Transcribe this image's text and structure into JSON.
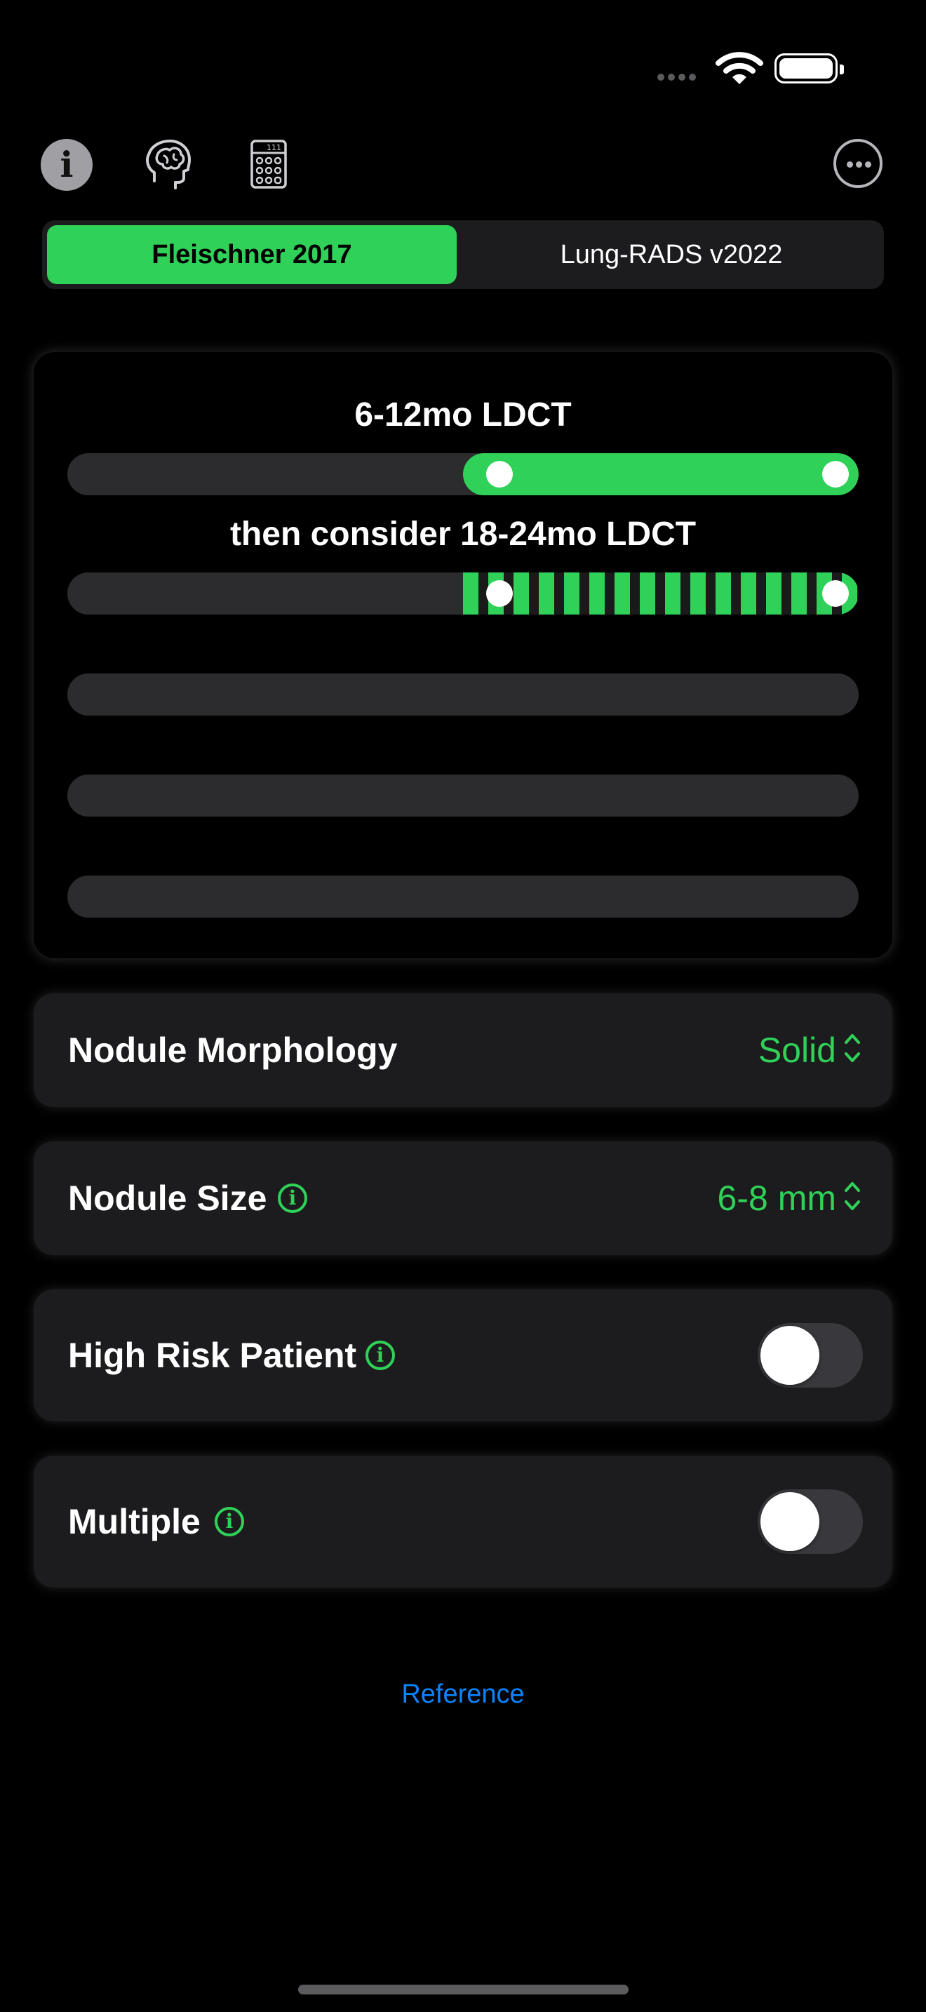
{
  "status_bar": {
    "icons": [
      "signal-dots-icon",
      "wifi-icon",
      "battery-icon"
    ],
    "battery_level": 1.0
  },
  "toolbar": {
    "icons": [
      "info-icon",
      "brain-icon",
      "calculator-icon",
      "more-icon"
    ],
    "calculator_display": "111"
  },
  "segmented": {
    "options": [
      {
        "label": "Fleischner 2017",
        "selected": true
      },
      {
        "label": "Lung-RADS v2022",
        "selected": false
      }
    ]
  },
  "results": {
    "primary_label": "6-12mo LDCT",
    "secondary_label": "then consider 18-24mo LDCT",
    "empty_tracks": 3
  },
  "options": {
    "morphology": {
      "label": "Nodule Morphology",
      "value": "Solid"
    },
    "size": {
      "label": "Nodule Size",
      "value": "6-8 mm"
    },
    "high_risk": {
      "label": "High Risk Patient",
      "on": false
    },
    "multiple": {
      "label": "Multiple",
      "on": false
    }
  },
  "footer": {
    "reference_label": "Reference"
  },
  "colors": {
    "accent": "#30d158",
    "link": "#0a84ff",
    "card": "#1c1c1e",
    "track": "#2c2c2e",
    "background": "#000000"
  }
}
